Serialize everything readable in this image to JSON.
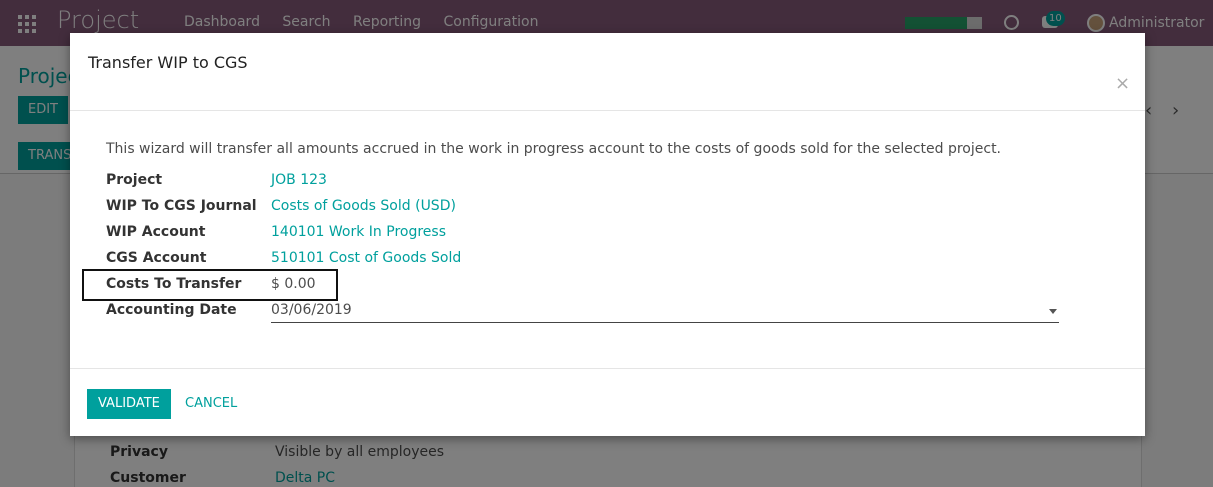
{
  "app": {
    "brand": "Project",
    "menu": [
      "Dashboard",
      "Search",
      "Reporting",
      "Configuration"
    ],
    "chat_count": "10",
    "user": "Administrator",
    "progress": 0.8,
    "colors": {
      "navbar": "#875a7b",
      "accent": "#00a09d"
    }
  },
  "control_panel": {
    "breadcrumb": "Projec",
    "edit_label": "EDIT",
    "transfer_label": "TRANS",
    "pager_prev": "‹",
    "pager_next": "›"
  },
  "sheet": {
    "rows": [
      {
        "label": "Privacy",
        "value": "Visible by all employees",
        "link": false
      },
      {
        "label": "Customer",
        "value": "Delta PC",
        "link": true
      }
    ]
  },
  "modal": {
    "title": "Transfer WIP to CGS",
    "close": "×",
    "intro": "This wizard will transfer all amounts accrued in the work in progress account to the costs of goods sold for the selected project.",
    "fields": [
      {
        "label": "Project",
        "value": "JOB 123",
        "link": true
      },
      {
        "label": "WIP To CGS Journal",
        "value": "Costs of Goods Sold (USD)",
        "link": true
      },
      {
        "label": "WIP Account",
        "value": "140101 Work In Progress",
        "link": true
      },
      {
        "label": "CGS Account",
        "value": "510101 Cost of Goods Sold",
        "link": true
      },
      {
        "label": "Costs To Transfer",
        "value": "$ 0.00",
        "link": false
      },
      {
        "label": "Accounting Date",
        "value": "03/06/2019",
        "link": false
      }
    ],
    "validate_label": "VALIDATE",
    "cancel_label": "CANCEL"
  }
}
